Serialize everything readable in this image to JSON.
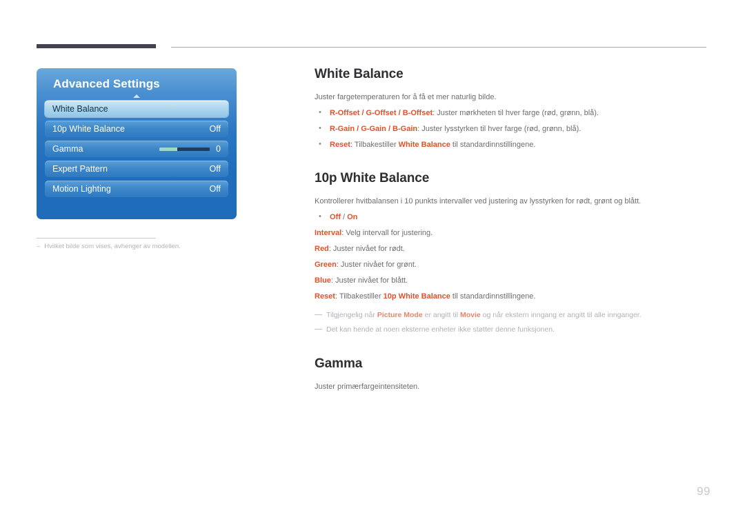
{
  "page": {
    "number": "99"
  },
  "osd": {
    "title": "Advanced Settings",
    "caret_icon": "chevron-up-icon",
    "rows": [
      {
        "label": "White Balance",
        "value": "",
        "type": "selected"
      },
      {
        "label": "10p White Balance",
        "value": "Off",
        "type": "value"
      },
      {
        "label": "Gamma",
        "value": "0",
        "type": "slider"
      },
      {
        "label": "Expert Pattern",
        "value": "Off",
        "type": "value"
      },
      {
        "label": "Motion Lighting",
        "value": "Off",
        "type": "value"
      }
    ],
    "footnote": {
      "dash": "–",
      "text": "Hvilket bilde som vises, avhenger av modellen."
    }
  },
  "sections": {
    "white_balance": {
      "title": "White Balance",
      "intro": "Juster fargetemperaturen for å få et mer naturlig bilde.",
      "bullets": [
        {
          "terms": "R-Offset / G-Offset / B-Offset",
          "rest": ": Juster mørkheten til hver farge (rød, grønn, blå)."
        },
        {
          "terms": "R-Gain / G-Gain / B-Gain",
          "rest": ": Juster lysstyrken til hver farge (rød, grønn, blå)."
        },
        {
          "term_a": "Reset",
          "mid": ": Tilbakestiller ",
          "term_b": "White Balance",
          "tail": " til standardinnstillingene."
        }
      ]
    },
    "ten_p_white_balance": {
      "title": "10p White Balance",
      "intro": "Kontrollerer hvitbalansen i 10 punkts intervaller ved justering av lysstyrken for rødt, grønt og blått.",
      "bullet_off_on": {
        "off": "Off",
        "slash": " / ",
        "on": "On"
      },
      "lines": [
        {
          "term": "Interval",
          "rest": ": Velg intervall for justering."
        },
        {
          "term": "Red",
          "rest": ": Juster nivået for rødt."
        },
        {
          "term": "Green",
          "rest": ": Juster nivået for grønt."
        },
        {
          "term": "Blue",
          "rest": ": Juster nivået for blått."
        }
      ],
      "reset_line": {
        "term_a": "Reset",
        "mid": ": Tilbakestiller ",
        "term_b": "10p White Balance",
        "tail": " til standardinnstillingene."
      },
      "notes": [
        {
          "pre": "Tilgjengelig når ",
          "term_a": "Picture Mode",
          "mid": " er angitt til ",
          "term_b": "Movie",
          "tail": " og når ekstern inngang er angitt til alle innganger."
        },
        {
          "pre": "Det kan hende at noen eksterne enheter ikke støtter denne funksjonen.",
          "term_a": "",
          "mid": "",
          "term_b": "",
          "tail": ""
        }
      ]
    },
    "gamma": {
      "title": "Gamma",
      "intro": "Juster primærfargeintensiteten."
    }
  },
  "colors": {
    "accent": "#e0512a",
    "osd_blue": "#1f6cbb",
    "heading": "#2e2e33",
    "body_text": "#6d6d73",
    "note_text": "#b1b1b8"
  }
}
